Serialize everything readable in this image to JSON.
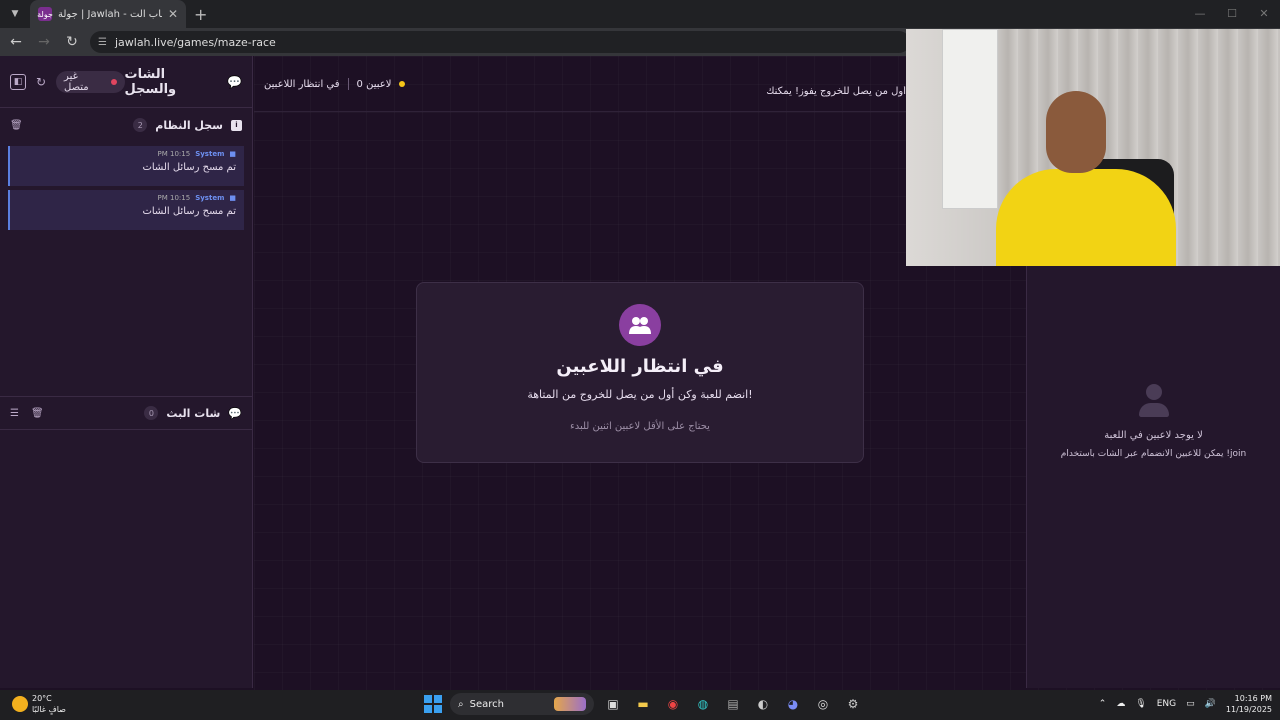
{
  "browser": {
    "tab_title": "جولة | Jawlah - منصة الألعاب الت...",
    "tab_favicon": "جولة",
    "url": "jawlah.live/games/maze-race"
  },
  "sidebar": {
    "title": "الشات والسجل",
    "status": "غير متصل",
    "system_log": {
      "title": "سجل النظام",
      "count": "2",
      "messages": [
        {
          "sender": "System",
          "time": "10:15 PM",
          "text": "تم مسح رسائل الشات"
        },
        {
          "sender": "System",
          "time": "10:15 PM",
          "text": "تم مسح رسائل الشات"
        }
      ]
    },
    "stream_chat": {
      "title": "شات البث",
      "count": "0"
    }
  },
  "main": {
    "player_count": "0 لاعبين",
    "game_state": "في انتظار اللاعبين",
    "ticker": "أول من يصل للخروج يفوز! يمكنك ...",
    "card": {
      "title": "في انتظار اللاعبين",
      "subtitle": "انضم للعبة وكن أول من يصل للخروج من المتاهة!",
      "hint": "يحتاج على الأقل لاعبين اثنين للبدء"
    },
    "players_panel": {
      "empty_title": "لا يوجد لاعبين في اللعبة",
      "empty_hint": "يمكن للاعبين الانضمام عبر الشات باستخدام !join"
    }
  },
  "taskbar": {
    "temperature": "20°C",
    "weather": "صافٍ غالبًا",
    "search_label": "Search",
    "language": "ENG",
    "time": "10:16 PM",
    "date": "11/19/2025"
  },
  "colors": {
    "accent_purple": "#8a3fa0",
    "offline_dot": "#e0455f",
    "waiting_dot": "#f5c518",
    "system_blue": "#6d8ff0"
  }
}
